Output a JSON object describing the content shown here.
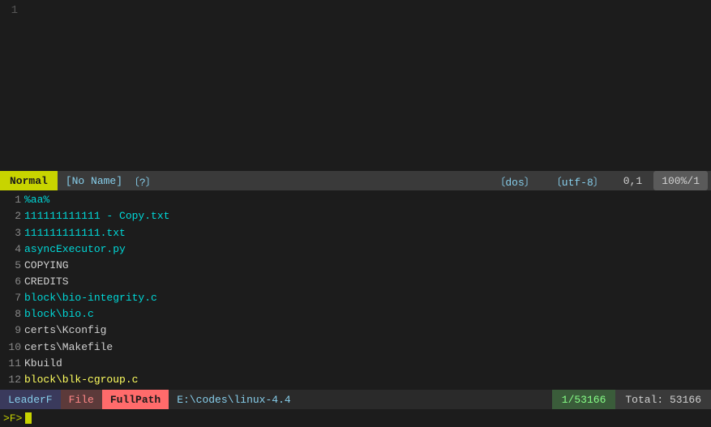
{
  "editor": {
    "line_number": "1",
    "tilde_lines": [
      "~",
      "~",
      "~",
      "~",
      "~",
      "~",
      "~",
      "~",
      "~",
      "~",
      "~",
      "~"
    ]
  },
  "status_bar": {
    "mode": "Normal",
    "filename": "[No Name]",
    "filetype": "〔?〕",
    "format": "〔dos〕",
    "encoding": "〔utf-8〕",
    "position": "0,1",
    "percent": "100%/1"
  },
  "file_list": [
    {
      "num": "1",
      "name": "%aa%",
      "type": "highlight"
    },
    {
      "num": "2",
      "name": "111111111111 - Copy.txt",
      "type": "highlight"
    },
    {
      "num": "3",
      "name": "111111111111.txt",
      "type": "highlight"
    },
    {
      "num": "4",
      "name": "asyncExecutor.py",
      "type": "highlight"
    },
    {
      "num": "5",
      "name": "COPYING",
      "type": "normal"
    },
    {
      "num": "6",
      "name": "CREDITS",
      "type": "normal"
    },
    {
      "num": "7",
      "name": "block\\bio-integrity.c",
      "type": "highlight"
    },
    {
      "num": "8",
      "name": "block\\bio.c",
      "type": "highlight"
    },
    {
      "num": "9",
      "name": "certs\\Kconfig",
      "type": "normal"
    },
    {
      "num": "10",
      "name": "certs\\Makefile",
      "type": "normal"
    },
    {
      "num": "11",
      "name": "Kbuild",
      "type": "normal"
    },
    {
      "num": "12",
      "name": "block\\blk-cgroup.c",
      "type": "highlight_yellow"
    }
  ],
  "leaderf_bar": {
    "leaderf_label": "LeaderF",
    "file_label": "File",
    "fullpath_label": "FullPath",
    "path": "E:\\codes\\linux-4.4",
    "count": "1/53166",
    "total": "Total: 53166"
  },
  "input_line": {
    "prompt": ">F>"
  }
}
